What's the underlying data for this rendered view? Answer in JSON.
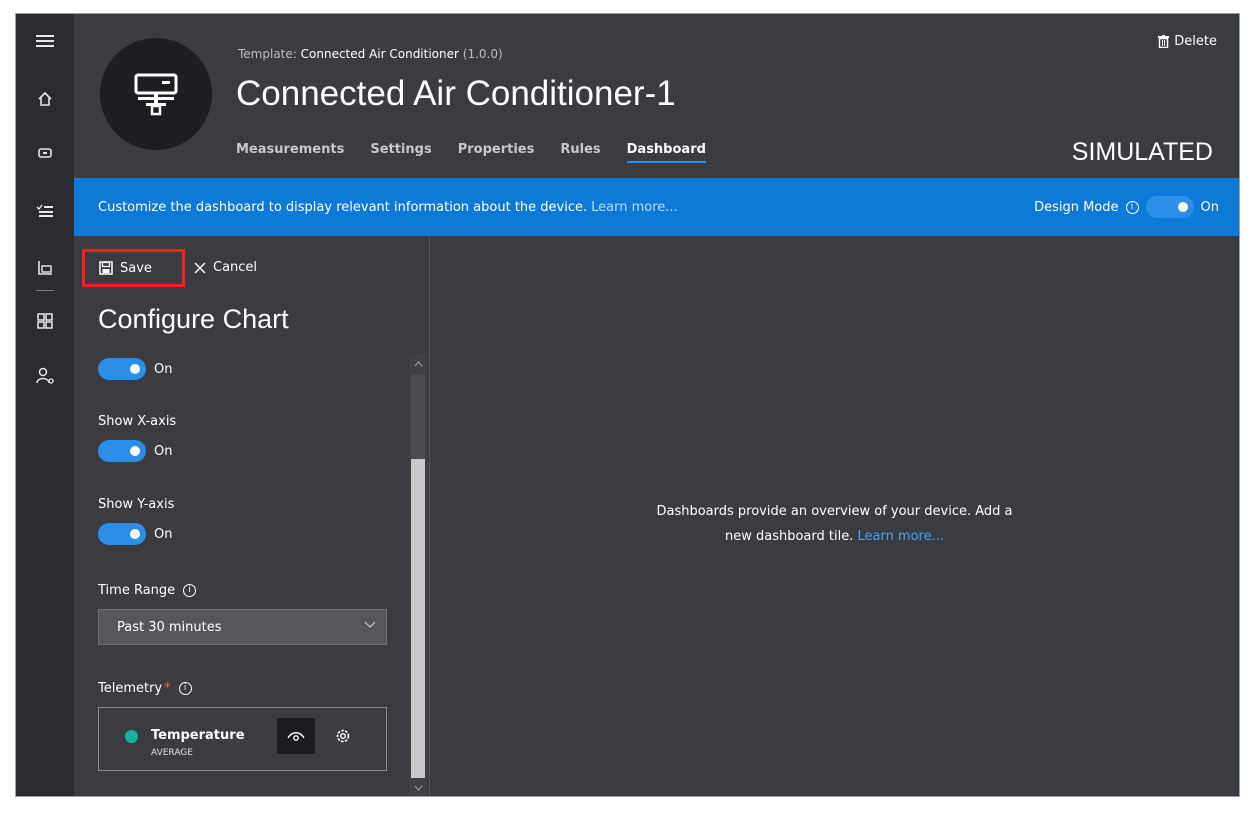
{
  "header": {
    "template_prefix": "Template:",
    "template_name": "Connected Air Conditioner",
    "template_version": "(1.0.0)",
    "device_title": "Connected Air Conditioner-1",
    "status": "SIMULATED",
    "delete_label": "Delete",
    "tabs": [
      {
        "label": "Measurements",
        "active": false
      },
      {
        "label": "Settings",
        "active": false
      },
      {
        "label": "Properties",
        "active": false
      },
      {
        "label": "Rules",
        "active": false
      },
      {
        "label": "Dashboard",
        "active": true
      }
    ]
  },
  "banner": {
    "text": "Customize the dashboard to display relevant information about the device.",
    "learn_more": "Learn more...",
    "design_mode_label": "Design Mode",
    "design_mode_state": "On"
  },
  "config": {
    "save_label": "Save",
    "cancel_label": "Cancel",
    "title": "Configure Chart",
    "first_toggle_state": "On",
    "show_x_axis_label": "Show X-axis",
    "show_x_axis_state": "On",
    "show_y_axis_label": "Show Y-axis",
    "show_y_axis_state": "On",
    "time_range_label": "Time Range",
    "time_range_value": "Past 30 minutes",
    "telemetry_label": "Telemetry",
    "telemetry_required_mark": "*",
    "telemetry_item": {
      "name": "Temperature",
      "aggregation": "AVERAGE",
      "color": "#16b39d"
    }
  },
  "dashboard": {
    "empty_line1": "Dashboards provide an overview of your device. Add a",
    "empty_line2": "new dashboard tile.",
    "learn_more": "Learn more..."
  },
  "colors": {
    "accent": "#0d7ad8",
    "toggle_on": "#2b8fe8",
    "highlight_box": "#ff1d1d"
  },
  "icons": {
    "rail": [
      "hamburger-icon",
      "home-icon",
      "devices-icon",
      "device-templates-icon",
      "analytics-icon",
      "dashboards-icon",
      "users-icon"
    ]
  }
}
